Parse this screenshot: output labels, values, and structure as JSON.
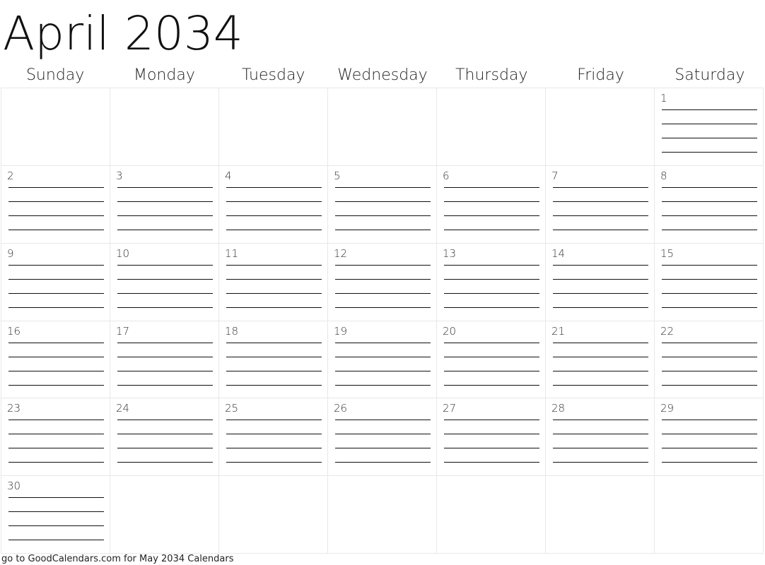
{
  "title": "April 2034",
  "weekdays": [
    "Sunday",
    "Monday",
    "Tuesday",
    "Wednesday",
    "Thursday",
    "Friday",
    "Saturday"
  ],
  "weeks": [
    [
      "",
      "",
      "",
      "",
      "",
      "",
      "1"
    ],
    [
      "2",
      "3",
      "4",
      "5",
      "6",
      "7",
      "8"
    ],
    [
      "9",
      "10",
      "11",
      "12",
      "13",
      "14",
      "15"
    ],
    [
      "16",
      "17",
      "18",
      "19",
      "20",
      "21",
      "22"
    ],
    [
      "23",
      "24",
      "25",
      "26",
      "27",
      "28",
      "29"
    ],
    [
      "30",
      "",
      "",
      "",
      "",
      "",
      ""
    ]
  ],
  "lines_per_day": 4,
  "footer": "go to GoodCalendars.com for May 2034 Calendars"
}
